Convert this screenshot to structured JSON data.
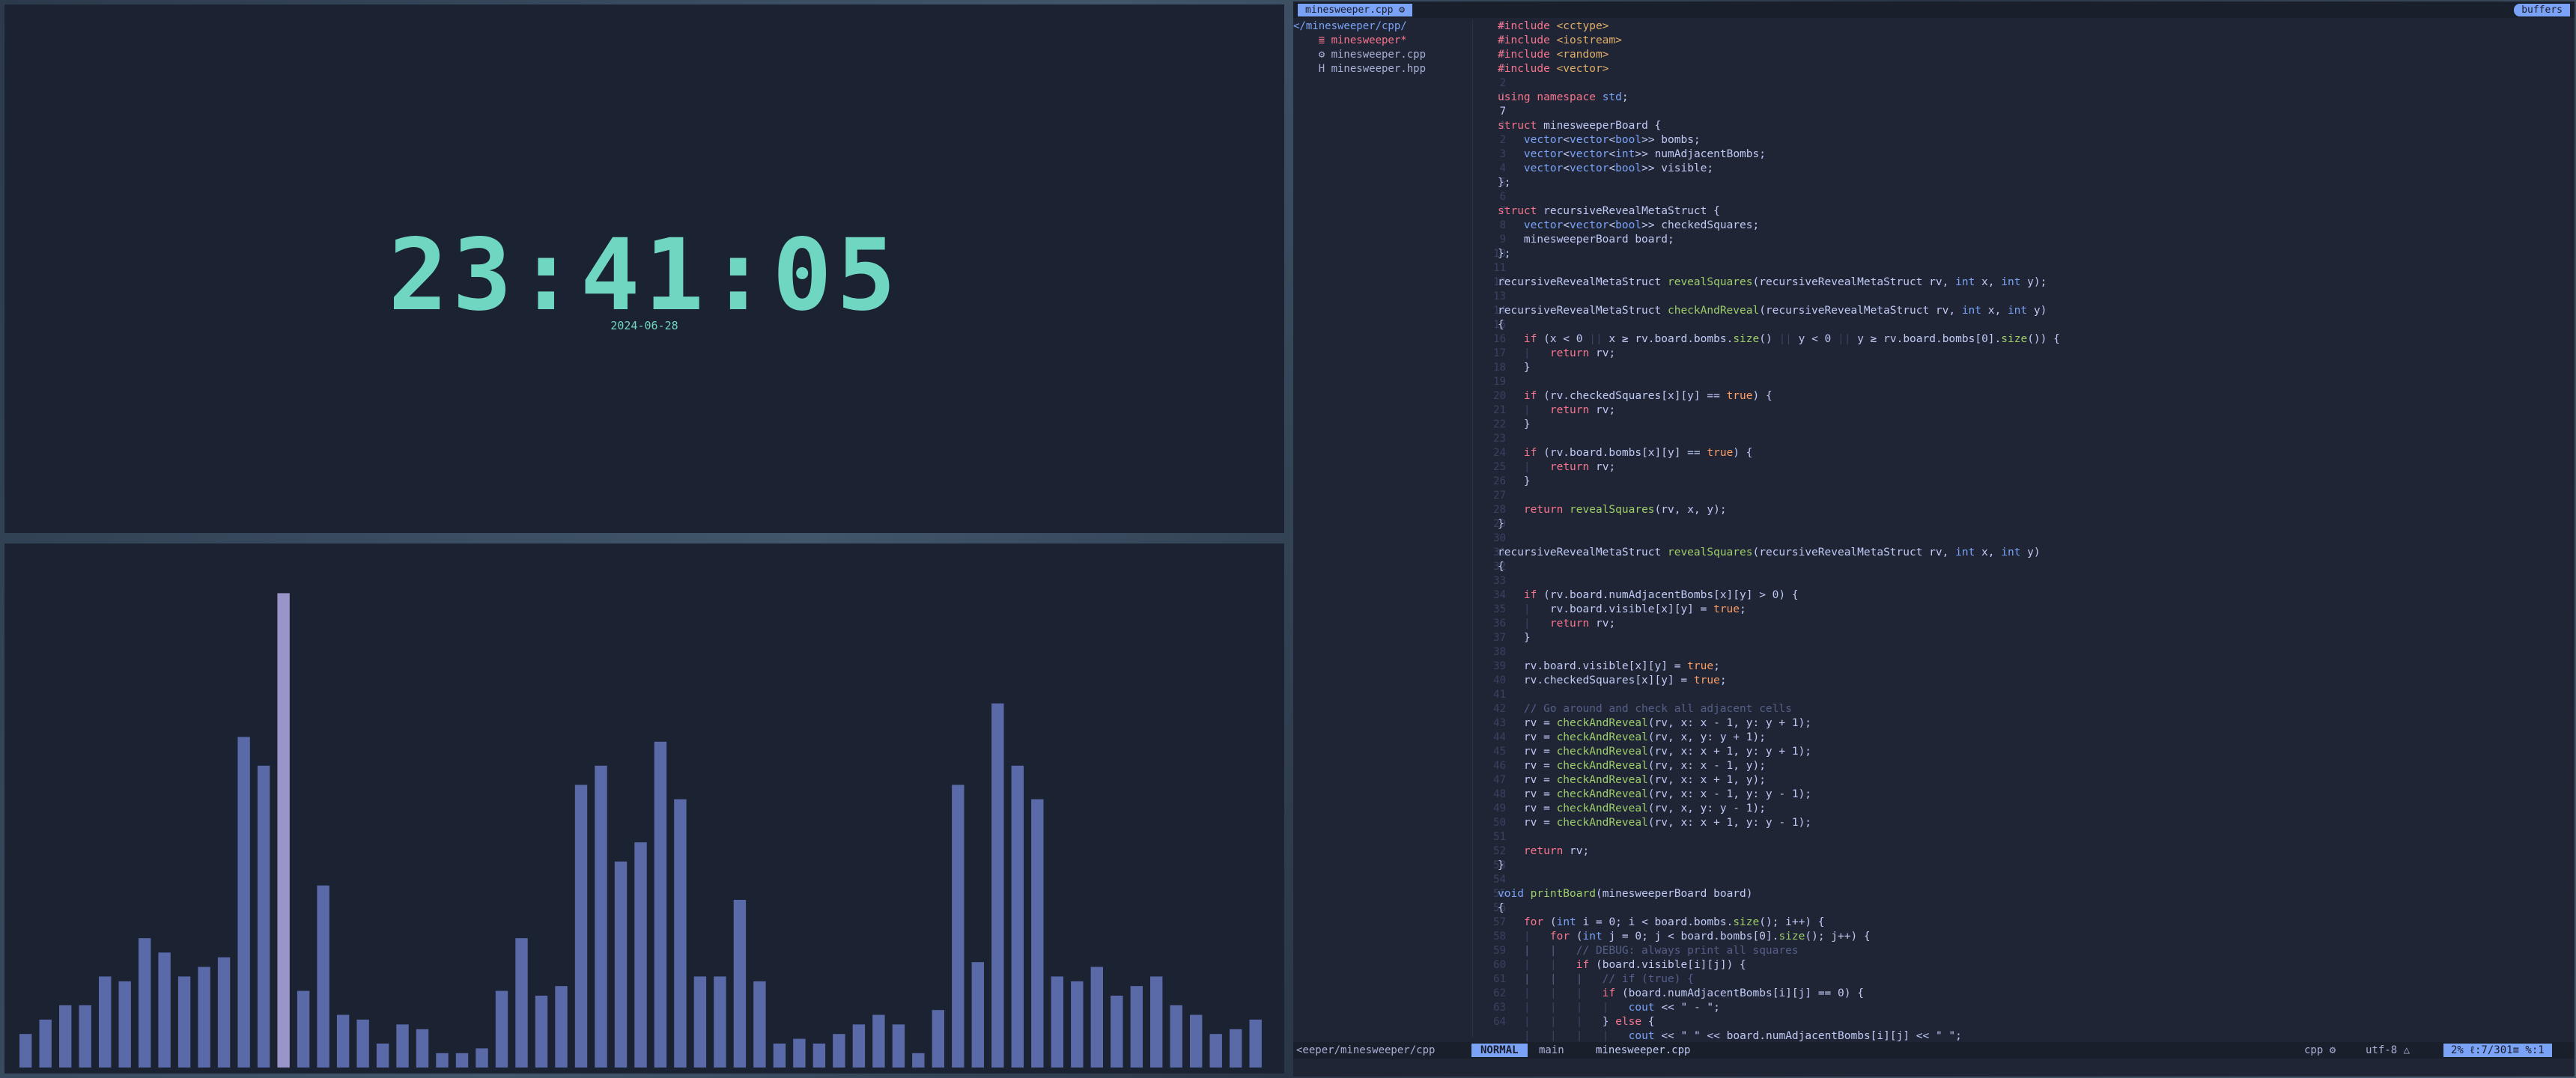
{
  "clock": {
    "time": "23:41:05",
    "date": "2024-06-28"
  },
  "visualizer": {
    "bar_color": "#5a6aa8",
    "peak_color": "#9a95c8",
    "levels": [
      0.07,
      0.1,
      0.13,
      0.13,
      0.19,
      0.18,
      0.27,
      0.24,
      0.19,
      0.21,
      0.23,
      0.69,
      0.63,
      0.99,
      0.16,
      0.38,
      0.11,
      0.1,
      0.05,
      0.09,
      0.08,
      0.03,
      0.03,
      0.04,
      0.16,
      0.27,
      0.15,
      0.17,
      0.59,
      0.63,
      0.43,
      0.47,
      0.68,
      0.56,
      0.19,
      0.19,
      0.35,
      0.18,
      0.05,
      0.06,
      0.05,
      0.07,
      0.09,
      0.11,
      0.09,
      0.03,
      0.12,
      0.59,
      0.22,
      0.76,
      0.63,
      0.56,
      0.19,
      0.18,
      0.21,
      0.15,
      0.17,
      0.19,
      0.13,
      0.11,
      0.07,
      0.08,
      0.1
    ]
  },
  "editor": {
    "tab_label": "minesweeper.cpp ⚙",
    "buffers_label": "buffers",
    "tree": [
      {
        "text": "</minesweeper/cpp/",
        "kind": "root"
      },
      {
        "text": "    ≣ minesweeper*",
        "kind": "mod"
      },
      {
        "text": "    ⚙ minesweeper.cpp",
        "kind": "file"
      },
      {
        "text": "    H minesweeper.hpp",
        "kind": "file"
      }
    ],
    "line_numbers": [
      "6",
      "5",
      "4",
      "3",
      "2",
      "1",
      "7",
      "1",
      "2",
      "3",
      "4",
      "5",
      "6",
      "7",
      "8",
      "9",
      "10",
      "11",
      "12",
      "13",
      "14",
      "15",
      "16",
      "17",
      "18",
      "19",
      "20",
      "21",
      "22",
      "23",
      "24",
      "25",
      "26",
      "27",
      "28",
      "29",
      "30",
      "31",
      "32",
      "33",
      "34",
      "35",
      "36",
      "37",
      "38",
      "39",
      "40",
      "41",
      "42",
      "43",
      "44",
      "45",
      "46",
      "47",
      "48",
      "49",
      "50",
      "51",
      "52",
      "53",
      "54",
      "55",
      "56",
      "57",
      "58",
      "59",
      "60",
      "61",
      "62",
      "63",
      "64"
    ],
    "cursor_line_index": 6,
    "lines": [
      "#include <cctype>",
      "#include <iostream>",
      "#include <random>",
      "#include <vector>",
      "",
      "using namespace std;",
      "",
      "struct minesweeperBoard {",
      "    vector<vector<bool>> bombs;",
      "    vector<vector<int>> numAdjacentBombs;",
      "    vector<vector<bool>> visible;",
      "};",
      "",
      "struct recursiveRevealMetaStruct {",
      "    vector<vector<bool>> checkedSquares;",
      "    minesweeperBoard board;",
      "};",
      "",
      "recursiveRevealMetaStruct revealSquares(recursiveRevealMetaStruct rv, int x, int y);",
      "",
      "recursiveRevealMetaStruct checkAndReveal(recursiveRevealMetaStruct rv, int x, int y)",
      "{",
      "    if (x < 0 || x ≥ rv.board.bombs.size() || y < 0 || y ≥ rv.board.bombs[0].size()) {",
      "    |   return rv;",
      "    }",
      "",
      "    if (rv.checkedSquares[x][y] == true) {",
      "    |   return rv;",
      "    }",
      "",
      "    if (rv.board.bombs[x][y] == true) {",
      "    |   return rv;",
      "    }",
      "",
      "    return revealSquares(rv, x, y);",
      "}",
      "",
      "recursiveRevealMetaStruct revealSquares(recursiveRevealMetaStruct rv, int x, int y)",
      "{",
      "",
      "    if (rv.board.numAdjacentBombs[x][y] > 0) {",
      "    |   rv.board.visible[x][y] = true;",
      "    |   return rv;",
      "    }",
      "",
      "    rv.board.visible[x][y] = true;",
      "    rv.checkedSquares[x][y] = true;",
      "",
      "    // Go around and check all adjacent cells",
      "    rv = checkAndReveal(rv, x: x - 1, y: y + 1);",
      "    rv = checkAndReveal(rv, x, y: y + 1);",
      "    rv = checkAndReveal(rv, x: x + 1, y: y + 1);",
      "    rv = checkAndReveal(rv, x: x - 1, y);",
      "    rv = checkAndReveal(rv, x: x + 1, y);",
      "    rv = checkAndReveal(rv, x: x - 1, y: y - 1);",
      "    rv = checkAndReveal(rv, x, y: y - 1);",
      "    rv = checkAndReveal(rv, x: x + 1, y: y - 1);",
      "",
      "    return rv;",
      "}",
      "",
      "void printBoard(minesweeperBoard board)",
      "{",
      "    for (int i = 0; i < board.bombs.size(); i++) {",
      "    |   for (int j = 0; j < board.bombs[0].size(); j++) {",
      "    |   |   // DEBUG: always print all squares",
      "    |   |   if (board.visible[i][j]) {",
      "    |   |   |   // if (true) {",
      "    |   |   |   if (board.numAdjacentBombs[i][j] == 0) {",
      "    |   |   |   |   cout << \" - \";",
      "    |   |   |   } else {",
      "    |   |   |   |   cout << \" \" << board.numAdjacentBombs[i][j] << \" \";"
    ],
    "status": {
      "path": "<eeper/minesweeper/cpp",
      "mode": "NORMAL",
      "branch": " main",
      "file": "minesweeper.cpp",
      "filetype": "cpp ⚙",
      "encoding": "utf-8 △",
      "position": "2% ℓ:7/301≡ %:1"
    }
  }
}
